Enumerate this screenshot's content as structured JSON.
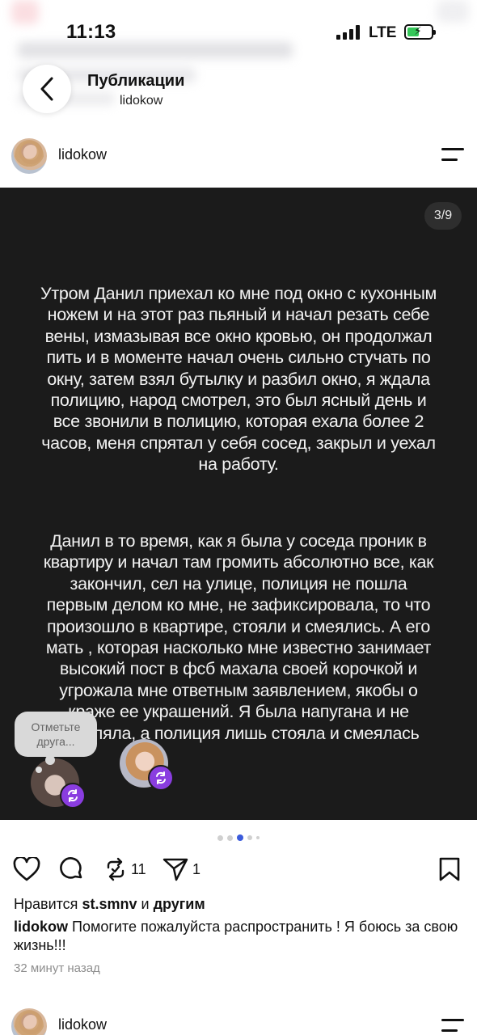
{
  "status_bar": {
    "time": "11:13",
    "network": "LTE",
    "battery_level": 0.5,
    "battery_charging": true
  },
  "header": {
    "title": "Публикации",
    "subtitle": "lidokow"
  },
  "post": {
    "username": "lidokow",
    "slide_counter": "3/9",
    "current_slide": 3,
    "total_slides": 9,
    "slide_paragraph_1": "Утром Данил приехал ко мне под окно с кухонным\nножем и на этот раз пьяный и начал резать себе\nвены, измазывая все окно кровью, он продолжал\nпить и в моменте начал очень сильно стучать по\nокну, затем взял бутылку и разбил окно, я ждала\nполицию, народ смотрел, это был ясный день и\nвсе звонили в полицию, которая ехала более 2\nчасов, меня спрятал у себя сосед, закрыл и уехал\nна работу.",
    "slide_paragraph_2": "Данил в то время, как я была у соседа проник в\nквартиру и начал там громить абсолютно все, как\nзакончил, сел на улице, полиция не пошла\nпервым делом ко мне, не зафиксировала, то что\nпроизошло в квартире, стояли и смеялись. А его\nмать , которая насколько мне известно занимает\nвысокий пост в фсб махала своей корочкой и\nугрожала мне ответным заявлением, якобы о\nкраже ее украшений. Я была напугана и не\nзаявляла, а полиция лишь стояла и смеялась",
    "tag_prompt": "Отметьте\nдруга...",
    "repost_count": "11",
    "share_count": "1",
    "likes_prefix": "Нравится",
    "likes_user": "st.smnv",
    "likes_conjunction": "и",
    "likes_others": "другим",
    "caption_user": "lidokow",
    "caption_text": "Помогите пожалуйста распространить ! Я боюсь за свою жизнь!!!",
    "time_ago": "32 минут назад"
  },
  "next_post": {
    "username": "lidokow"
  },
  "colors": {
    "media_bg": "#1b1b1b",
    "repost_badge": "#8a3de0",
    "active_dot": "#3b5bdb"
  }
}
